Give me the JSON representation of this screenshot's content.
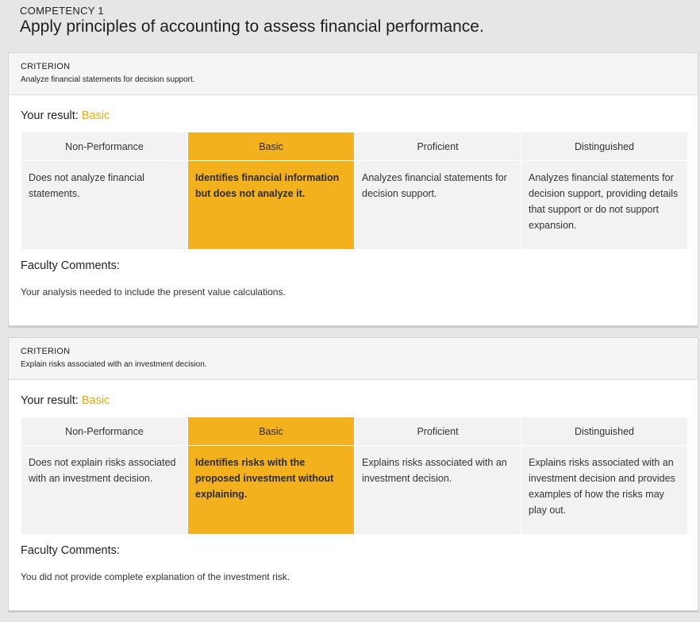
{
  "competency": {
    "label": "COMPETENCY 1",
    "title": "Apply principles of accounting to assess financial performance."
  },
  "criteria": [
    {
      "criterion_label": "CRITERION",
      "description": "Analyze financial statements for decision support.",
      "result_label": "Your result:",
      "result_value": "Basic",
      "levels": [
        {
          "name": "Non-Performance",
          "text": "Does not analyze financial statements."
        },
        {
          "name": "Basic",
          "text": "Identifies financial information but does not analyze it."
        },
        {
          "name": "Proficient",
          "text": "Analyzes financial statements for decision support."
        },
        {
          "name": "Distinguished",
          "text": "Analyzes financial statements for decision support, providing details that support or do not support expansion."
        }
      ],
      "selected_level": "Basic",
      "comments_label": "Faculty Comments:",
      "comments": "Your analysis needed to include the present value calculations."
    },
    {
      "criterion_label": "CRITERION",
      "description": "Explain risks associated with an investment decision.",
      "result_label": "Your result:",
      "result_value": "Basic",
      "levels": [
        {
          "name": "Non-Performance",
          "text": "Does not explain risks associated with an investment decision."
        },
        {
          "name": "Basic",
          "text": "Identifies risks with the proposed investment without explaining."
        },
        {
          "name": "Proficient",
          "text": "Explains risks associated with an investment decision."
        },
        {
          "name": "Distinguished",
          "text": "Explains risks associated with an investment decision and provides examples of how the risks may play out."
        }
      ],
      "selected_level": "Basic",
      "comments_label": "Faculty Comments:",
      "comments": "You did not provide complete explanation of the investment risk."
    }
  ],
  "colors": {
    "selected_fill": "#f2b11d",
    "result_text": "#e8a91c",
    "cell_fill": "#f2f2f2",
    "page_bg": "#e6e6e6"
  }
}
